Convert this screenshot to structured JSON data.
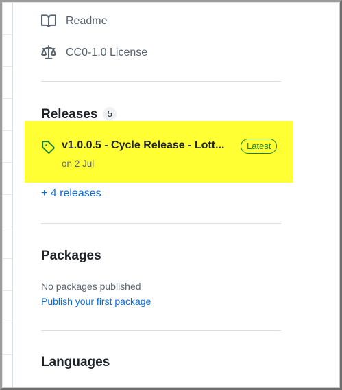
{
  "sidebar": {
    "links": [
      {
        "label": "Readme",
        "icon": "book-icon"
      },
      {
        "label": "CC0-1.0 License",
        "icon": "law-scale-icon"
      }
    ]
  },
  "releases": {
    "title": "Releases",
    "count": "5",
    "latest": {
      "name": "v1.0.0.5 - Cycle Release - Lott...",
      "badge": "Latest",
      "date": "on 2 Jul"
    },
    "more_link": "+ 4 releases"
  },
  "packages": {
    "title": "Packages",
    "empty_text": "No packages published",
    "publish_link": "Publish your first package"
  },
  "languages": {
    "title": "Languages"
  },
  "colors": {
    "highlight": "#ffff33",
    "link": "#0969da",
    "badge_green": "#1a7f37",
    "muted_text": "#59636e"
  }
}
